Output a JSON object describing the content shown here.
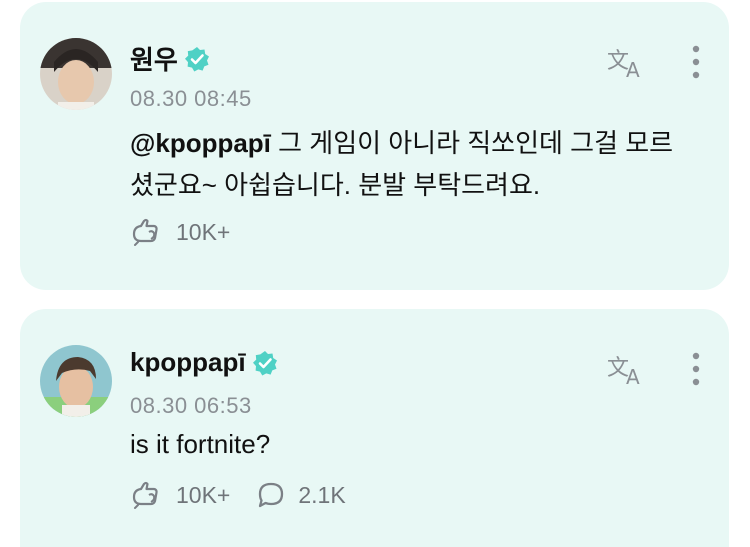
{
  "posts": [
    {
      "author": "원우",
      "timestamp": "08.30 08:45",
      "mention": "@kpoppapī",
      "text": " 그 게임이 아니라 직쏘인데 그걸 모르셨군요~ 아쉽습니다. 분발 부탁드려요.",
      "likes": "10K+",
      "icons": [
        "avatar",
        "verified-badge-icon",
        "translate-icon",
        "more-vertical-icon",
        "like-icon"
      ]
    },
    {
      "author": "kpoppapī",
      "timestamp": "08.30 06:53",
      "text": "is it fortnite?",
      "likes": "10K+",
      "comments": "2.1K",
      "icons": [
        "avatar",
        "verified-badge-icon",
        "translate-icon",
        "more-vertical-icon",
        "like-icon",
        "comment-icon"
      ]
    }
  ],
  "colors": {
    "card_background": "#e8f8f5",
    "verified": "#4fd1c5",
    "muted_text": "#8a8f94",
    "icon": "#7b8086"
  }
}
